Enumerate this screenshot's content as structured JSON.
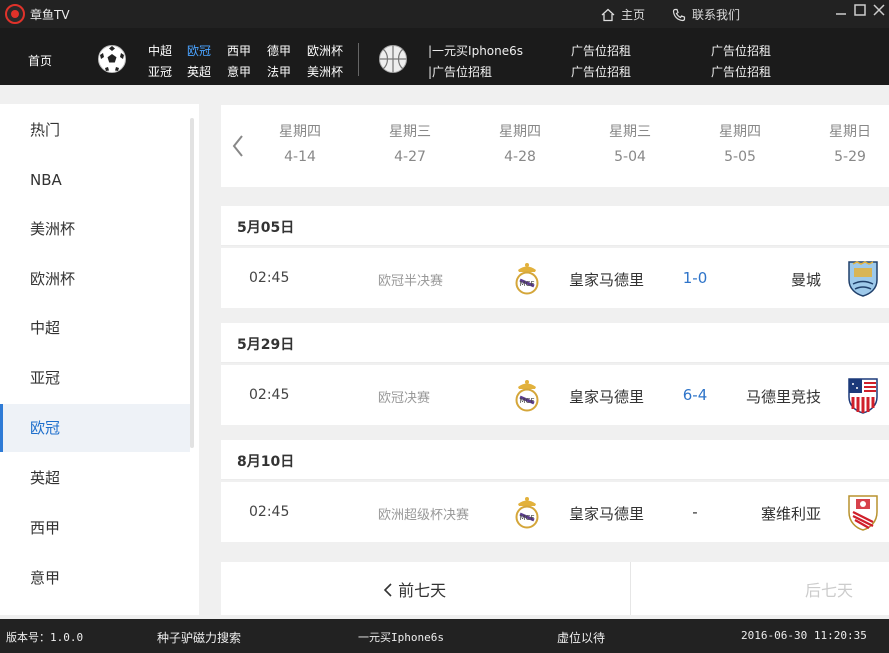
{
  "titlebar": {
    "app_title": "章鱼TV",
    "home_label": "主页",
    "contact_label": "联系我们"
  },
  "nav": {
    "home": "首页",
    "leagues": [
      {
        "label": "中超",
        "active": false
      },
      {
        "label": "欧冠",
        "active": true
      },
      {
        "label": "西甲",
        "active": false
      },
      {
        "label": "德甲",
        "active": false
      },
      {
        "label": "欧洲杯",
        "active": false
      },
      {
        "label": "亚冠",
        "active": false
      },
      {
        "label": "英超",
        "active": false
      },
      {
        "label": "意甲",
        "active": false
      },
      {
        "label": "法甲",
        "active": false
      },
      {
        "label": "美洲杯",
        "active": false
      }
    ],
    "ads": [
      "|一元买Iphone6s",
      "广告位招租",
      "广告位招租",
      "|广告位招租",
      "广告位招租",
      "广告位招租"
    ]
  },
  "sidebar": {
    "items": [
      "热门",
      "NBA",
      "美洲杯",
      "欧洲杯",
      "中超",
      "亚冠",
      "欧冠",
      "英超",
      "西甲",
      "意甲"
    ],
    "active_index": 6
  },
  "dates": [
    {
      "weekday": "星期四",
      "date": "4-14"
    },
    {
      "weekday": "星期三",
      "date": "4-27"
    },
    {
      "weekday": "星期四",
      "date": "4-28"
    },
    {
      "weekday": "星期三",
      "date": "5-04"
    },
    {
      "weekday": "星期四",
      "date": "5-05"
    },
    {
      "weekday": "星期日",
      "date": "5-29"
    }
  ],
  "groups": [
    {
      "date": "5月05日",
      "match": {
        "time": "02:45",
        "competition": "欧冠半决赛",
        "home": "皇家马德里",
        "score": "1-0",
        "away": "曼城",
        "away_logo": "man-city-crest"
      }
    },
    {
      "date": "5月29日",
      "match": {
        "time": "02:45",
        "competition": "欧冠决赛",
        "home": "皇家马德里",
        "score": "6-4",
        "away": "马德里竞技",
        "away_logo": "atletico-crest"
      }
    },
    {
      "date": "8月10日",
      "match": {
        "time": "02:45",
        "competition": "欧洲超级杯决赛",
        "home": "皇家马德里",
        "score": "-",
        "away": "塞维利亚",
        "away_logo": "sevilla-crest"
      }
    }
  ],
  "pager": {
    "prev": "前七天",
    "next": "后七天"
  },
  "statusbar": {
    "version": "版本号：1.0.0",
    "link1": "种子驴磁力搜索",
    "link2": "一元买Iphone6s",
    "link3": "虚位以待",
    "datetime": "2016-06-30 11:20:35"
  },
  "colors": {
    "accent": "#2e7bd6",
    "title_bg": "#222222",
    "nav_bg": "#1b1b1b",
    "score": "#2e74c9"
  }
}
